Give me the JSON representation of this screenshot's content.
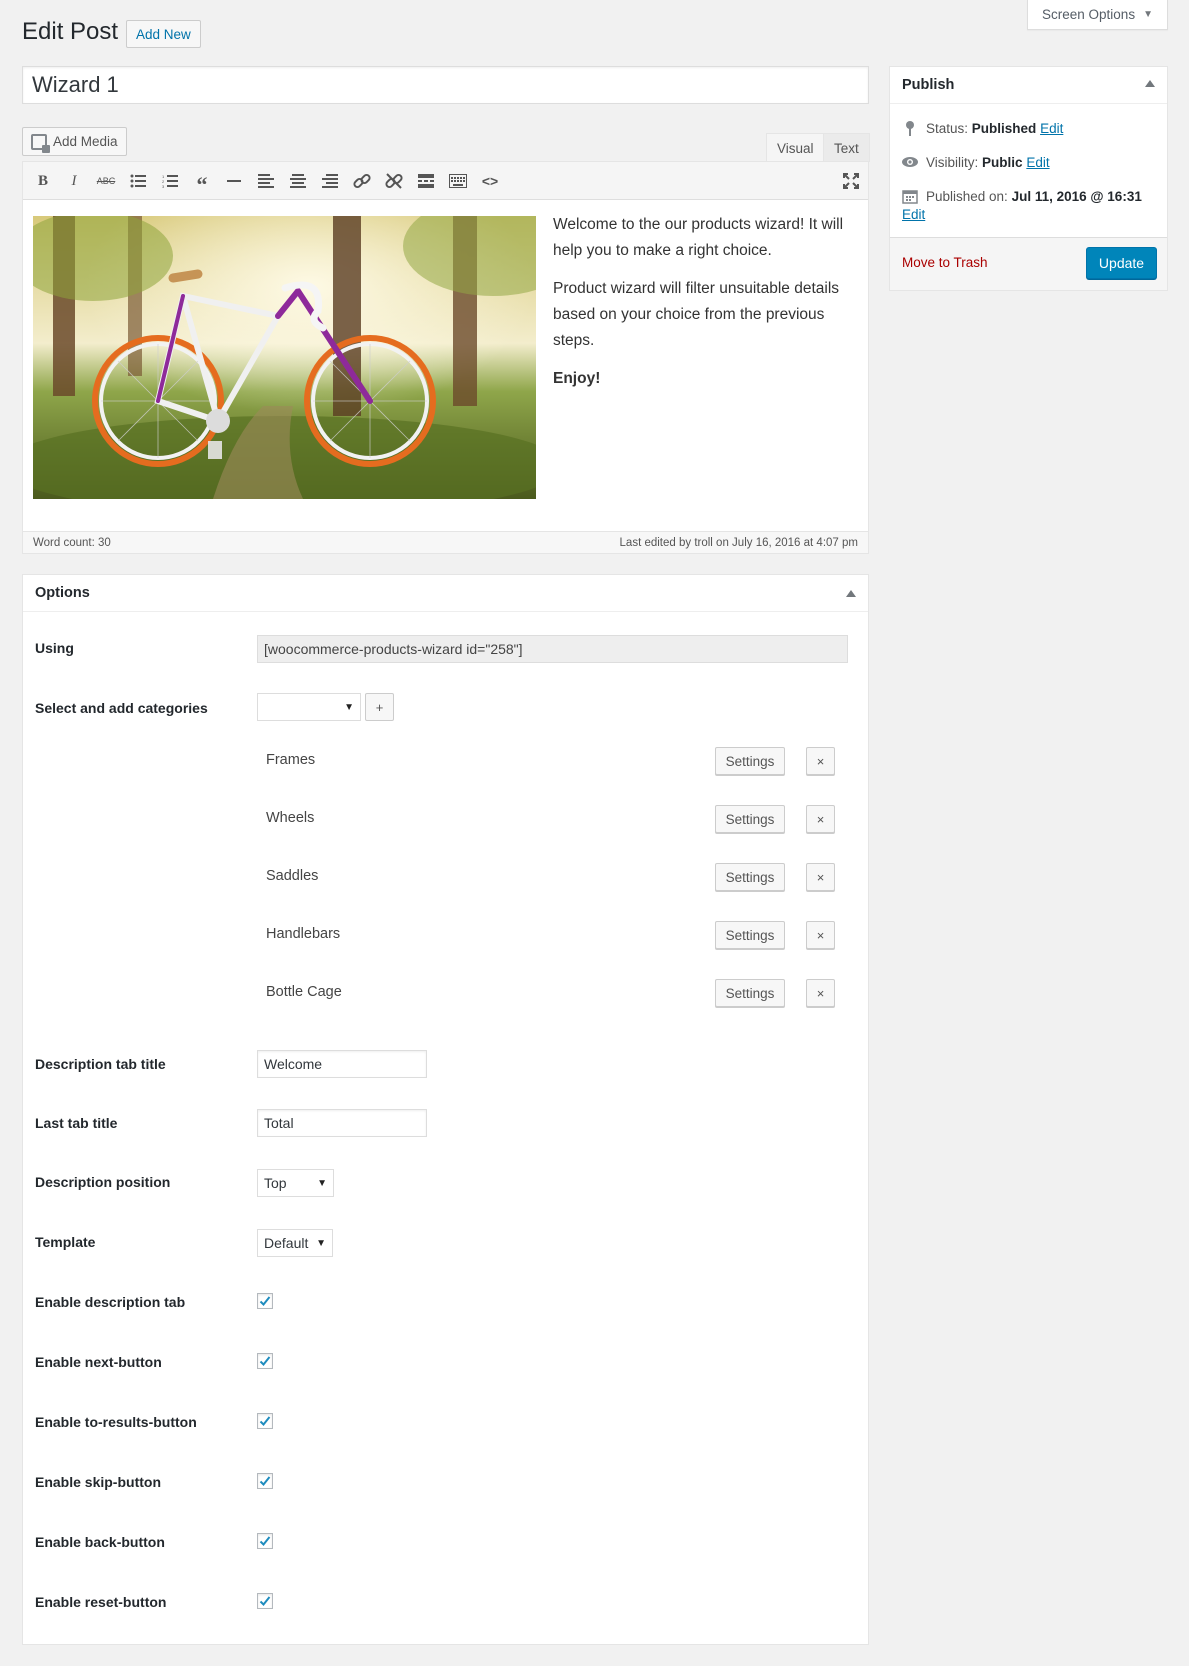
{
  "screen_options": {
    "label": "Screen Options"
  },
  "header": {
    "title": "Edit Post",
    "add_new": "Add New"
  },
  "post": {
    "title": "Wizard 1"
  },
  "editor": {
    "add_media": "Add Media",
    "tabs": {
      "visual": "Visual",
      "text": "Text"
    },
    "toolbar_icons": [
      "bold-icon",
      "italic-icon",
      "strikethrough-icon",
      "bullet-list-icon",
      "numbered-list-icon",
      "blockquote-icon",
      "horizontal-line-icon",
      "align-left-icon",
      "align-center-icon",
      "align-right-icon",
      "link-icon",
      "unlink-icon",
      "read-more-icon",
      "toolbar-toggle-icon",
      "code-icon",
      "fullscreen-icon"
    ],
    "content": {
      "p1": "Welcome to the our products wizard! It will help you to make a right choice.",
      "p2": "Product wizard will filter unsuitable details based on your choice from the previous steps.",
      "p3": "Enjoy!"
    },
    "word_count": "Word count: 30",
    "last_edited": "Last edited by troll on July 16, 2016 at 4:07 pm"
  },
  "publish": {
    "title": "Publish",
    "status_label": "Status:",
    "status_value": "Published",
    "visibility_label": "Visibility:",
    "visibility_value": "Public",
    "published_label": "Published on:",
    "published_value": "Jul 11, 2016 @ 16:31",
    "edit": "Edit",
    "trash": "Move to Trash",
    "update": "Update"
  },
  "options": {
    "title": "Options",
    "using_label": "Using",
    "using_value": "[woocommerce-products-wizard id=\"258\"]",
    "categories_label": "Select and add categories",
    "category_select_value": "",
    "plus": "+",
    "settings": "Settings",
    "remove": "×",
    "categories": [
      "Frames",
      "Wheels",
      "Saddles",
      "Handlebars",
      "Bottle Cage"
    ],
    "desc_tab_title_label": "Description tab title",
    "desc_tab_title_value": "Welcome",
    "last_tab_title_label": "Last tab title",
    "last_tab_title_value": "Total",
    "desc_position_label": "Description position",
    "desc_position_value": "Top",
    "template_label": "Template",
    "template_value": "Default",
    "checkboxes": [
      {
        "label": "Enable description tab",
        "checked": true
      },
      {
        "label": "Enable next-button",
        "checked": true
      },
      {
        "label": "Enable to-results-button",
        "checked": true
      },
      {
        "label": "Enable skip-button",
        "checked": true
      },
      {
        "label": "Enable back-button",
        "checked": true
      },
      {
        "label": "Enable reset-button",
        "checked": true
      }
    ]
  },
  "colors": {
    "primary": "#0085ba",
    "link": "#0073aa",
    "trash": "#a00000",
    "check": "#1e8cbe"
  }
}
